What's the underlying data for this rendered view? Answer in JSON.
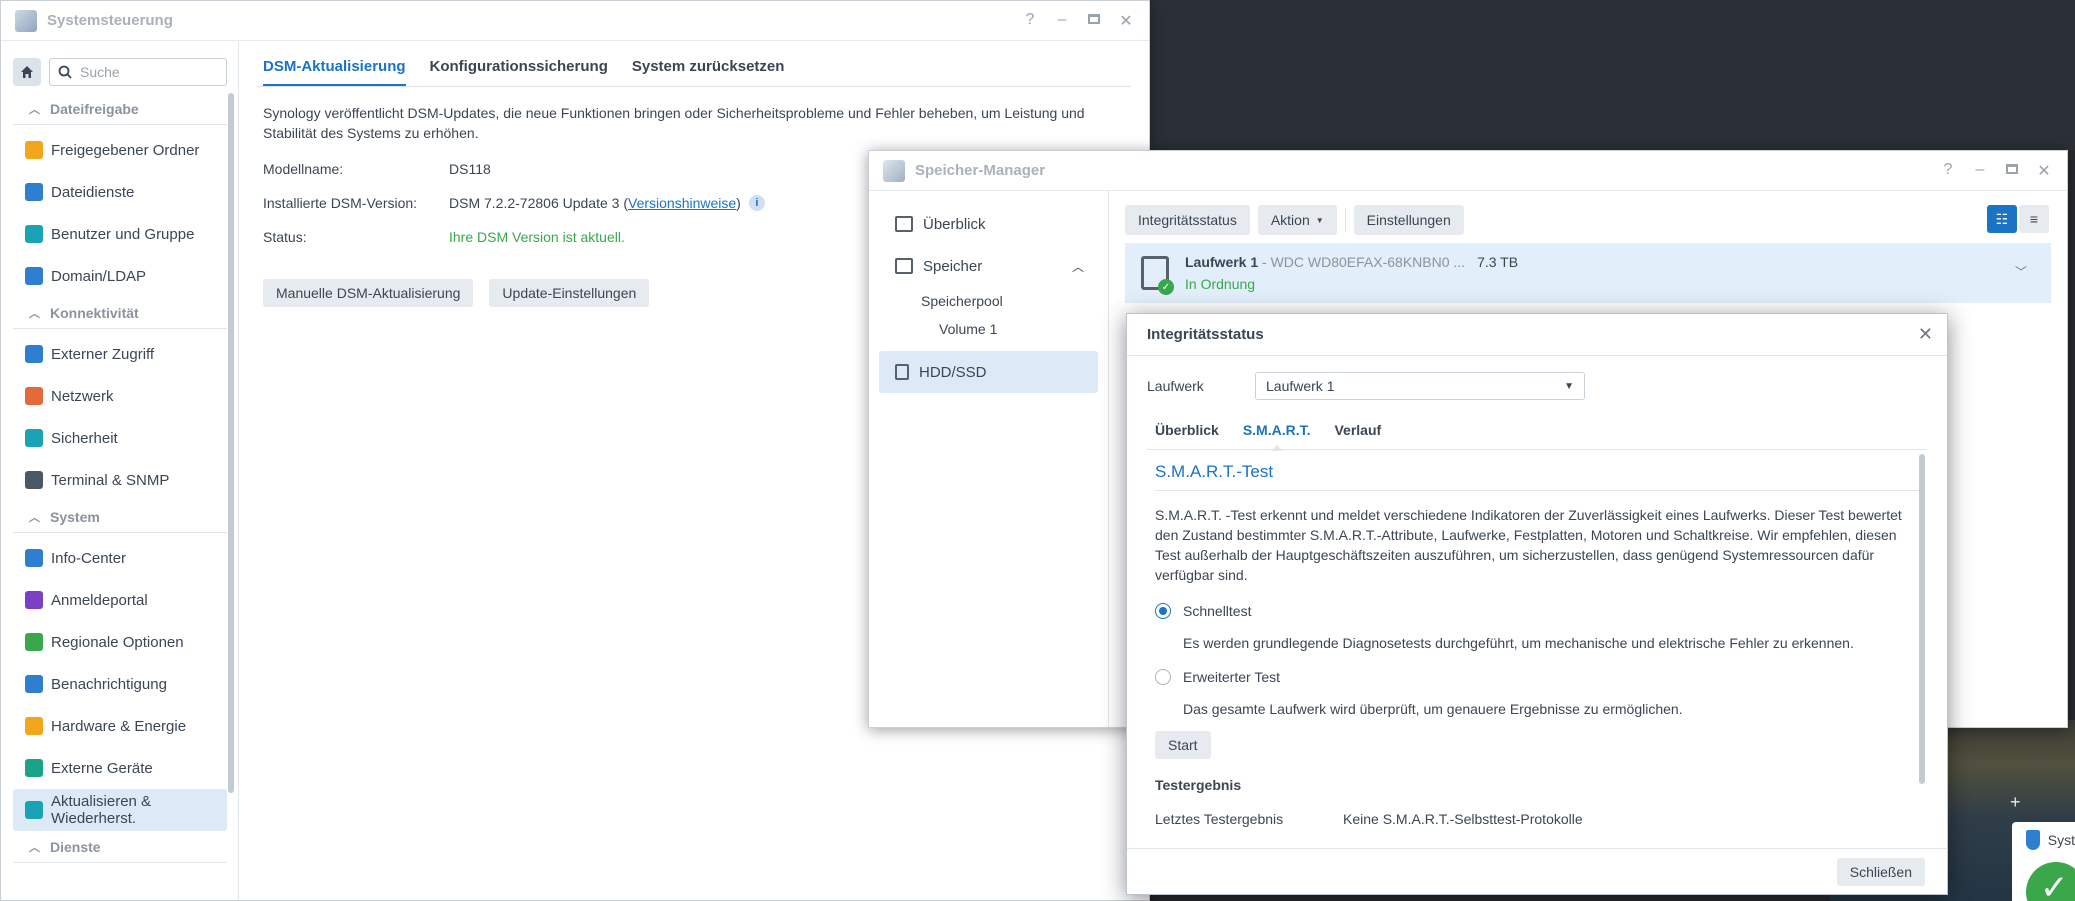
{
  "sys": {
    "title": "Systemsteuerung",
    "search_placeholder": "Suche",
    "sections": [
      {
        "label": "Dateifreigabe",
        "items": [
          {
            "label": "Freigegebener Ordner",
            "icon": "folder-icon",
            "color": "#f2a71b"
          },
          {
            "label": "Dateidienste",
            "icon": "file-services-icon",
            "color": "#2f7fd0"
          },
          {
            "label": "Benutzer und Gruppe",
            "icon": "users-icon",
            "color": "#1aa3b5"
          },
          {
            "label": "Domain/LDAP",
            "icon": "domain-icon",
            "color": "#2f7fd0"
          }
        ]
      },
      {
        "label": "Konnektivität",
        "items": [
          {
            "label": "Externer Zugriff",
            "icon": "external-access-icon",
            "color": "#2f7fd0"
          },
          {
            "label": "Netzwerk",
            "icon": "network-icon",
            "color": "#e36b3b"
          },
          {
            "label": "Sicherheit",
            "icon": "shield-icon",
            "color": "#1aa3b5"
          },
          {
            "label": "Terminal & SNMP",
            "icon": "terminal-icon",
            "color": "#4b5866"
          }
        ]
      },
      {
        "label": "System",
        "items": [
          {
            "label": "Info-Center",
            "icon": "info-icon",
            "color": "#2f7fd0"
          },
          {
            "label": "Anmeldeportal",
            "icon": "login-portal-icon",
            "color": "#7a3fc4"
          },
          {
            "label": "Regionale Optionen",
            "icon": "regional-icon",
            "color": "#3aa74b"
          },
          {
            "label": "Benachrichtigung",
            "icon": "notification-icon",
            "color": "#2f7fd0"
          },
          {
            "label": "Hardware & Energie",
            "icon": "bulb-icon",
            "color": "#f2a71b"
          },
          {
            "label": "Externe Geräte",
            "icon": "external-devices-icon",
            "color": "#1aa386"
          },
          {
            "label": "Aktualisieren & Wiederherst.",
            "icon": "update-restore-icon",
            "color": "#1aa3b5"
          }
        ]
      },
      {
        "label": "Dienste",
        "items": []
      }
    ],
    "tabs": [
      "DSM-Aktualisierung",
      "Konfigurationssicherung",
      "System zurücksetzen"
    ],
    "intro": "Synology veröffentlicht DSM-Updates, die neue Funktionen bringen oder Sicherheitsprobleme und Fehler beheben, um Leistung und Stabilität des Systems zu erhöhen.",
    "model_label": "Modellname:",
    "model_value": "DS118",
    "version_label": "Installierte DSM-Version:",
    "version_value": "DSM 7.2.2-72806 Update 3 (",
    "version_link": "Versionshinweise",
    "version_close": ")",
    "status_label": "Status:",
    "status_value": "Ihre DSM Version ist aktuell.",
    "btn_manual": "Manuelle DSM-Aktualisierung",
    "btn_settings": "Update-Einstellungen"
  },
  "sm": {
    "title": "Speicher-Manager",
    "nav_overview": "Überblick",
    "nav_storage": "Speicher",
    "nav_pool": "Speicherpool",
    "nav_volume": "Volume 1",
    "nav_hdd": "HDD/SSD",
    "btn_health": "Integritätsstatus",
    "btn_action": "Aktion",
    "btn_settings": "Einstellungen",
    "disk_name": "Laufwerk 1",
    "disk_model": " - WDC WD80EFAX-68KNBN0 ...",
    "disk_size": "7.3 TB",
    "disk_status": "In Ordnung"
  },
  "dialog": {
    "title": "Integritätsstatus",
    "drive_label": "Laufwerk",
    "drive_value": "Laufwerk 1",
    "tabs": [
      "Überblick",
      "S.M.A.R.T.",
      "Verlauf"
    ],
    "smart_title": "S.M.A.R.T.-Test",
    "smart_desc": "S.M.A.R.T. -Test erkennt und meldet verschiedene Indikatoren der Zuverlässigkeit eines Laufwerks. Dieser Test bewertet den Zustand bestimmter S.M.A.R.T.-Attribute, Laufwerke, Festplatten, Motoren und Schaltkreise. Wir empfehlen, diesen Test außerhalb der Hauptgeschäftszeiten auszuführen, um sicherzustellen, dass genügend Systemressourcen dafür verfügbar sind.",
    "quick_label": "Schnelltest",
    "quick_desc": "Es werden grundlegende Diagnosetests durchgeführt, um mechanische und elektrische Fehler zu erkennen.",
    "ext_label": "Erweiterter Test",
    "ext_desc": "Das gesamte Laufwerk wird überprüft, um genauere Ergebnisse zu ermöglichen.",
    "start": "Start",
    "result_title": "Testergebnis",
    "last_label": "Letztes Testergebnis",
    "last_value": "Keine S.M.A.R.T.-Selbsttest-Protokolle",
    "close": "Schließen"
  },
  "notif": {
    "title": "Syst"
  }
}
